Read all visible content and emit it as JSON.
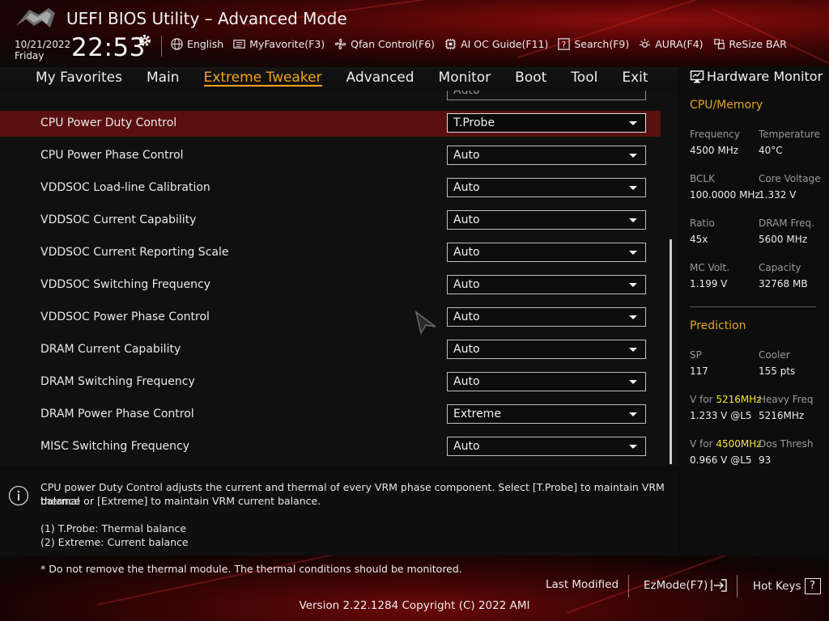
{
  "header": {
    "title": "UEFI BIOS Utility – Advanced Mode",
    "date": "10/21/2022",
    "day": "Friday",
    "time": "22:53",
    "toolbar": [
      {
        "label": "English",
        "icon": "globe-icon"
      },
      {
        "label": "MyFavorite(F3)",
        "icon": "favorite-list-icon"
      },
      {
        "label": "Qfan Control(F6)",
        "icon": "fan-icon"
      },
      {
        "label": "AI OC Guide(F11)",
        "icon": "chip-icon"
      },
      {
        "label": "Search(F9)",
        "icon": "search-question-icon"
      },
      {
        "label": "AURA(F4)",
        "icon": "aura-light-icon"
      },
      {
        "label": "ReSize BAR",
        "icon": "resize-bar-icon"
      }
    ]
  },
  "menu": {
    "items": [
      "My Favorites",
      "Main",
      "Extreme Tweaker",
      "Advanced",
      "Monitor",
      "Boot",
      "Tool",
      "Exit"
    ],
    "active": "Extreme Tweaker"
  },
  "settings": {
    "partial_value": "Auto",
    "rows": [
      {
        "label": "CPU Power Duty Control",
        "value": "T.Probe"
      },
      {
        "label": "CPU Power Phase Control",
        "value": "Auto"
      },
      {
        "label": "VDDSOC Load-line Calibration",
        "value": "Auto"
      },
      {
        "label": "VDDSOC Current Capability",
        "value": "Auto"
      },
      {
        "label": "VDDSOC Current Reporting Scale",
        "value": "Auto"
      },
      {
        "label": "VDDSOC Switching Frequency",
        "value": "Auto"
      },
      {
        "label": "VDDSOC Power Phase Control",
        "value": "Auto"
      },
      {
        "label": "DRAM Current Capability",
        "value": "Auto"
      },
      {
        "label": "DRAM Switching Frequency",
        "value": "Auto"
      },
      {
        "label": "DRAM Power Phase Control",
        "value": "Extreme"
      },
      {
        "label": "MISC Switching Frequency",
        "value": "Auto"
      }
    ]
  },
  "help": {
    "line1": "CPU power Duty Control adjusts the current and thermal of every VRM phase component. Select [T.Probe] to maintain VRM thermal",
    "line2": "balance or [Extreme] to maintain VRM current balance.",
    "line3": "(1) T.Probe: Thermal balance",
    "line4": "(2) Extreme: Current balance"
  },
  "hardware_monitor": {
    "title": "Hardware Monitor",
    "cpu_memory": {
      "heading": "CPU/Memory",
      "frequency_label": "Frequency",
      "frequency": "4500 MHz",
      "temperature_label": "Temperature",
      "temperature": "40°C",
      "bclk_label": "BCLK",
      "bclk": "100.0000 MHz",
      "core_voltage_label": "Core Voltage",
      "core_voltage": "1.332 V",
      "ratio_label": "Ratio",
      "ratio": "45x",
      "dram_freq_label": "DRAM Freq.",
      "dram_freq": "5600 MHz",
      "mc_volt_label": "MC Volt.",
      "mc_volt": "1.199 V",
      "capacity_label": "Capacity",
      "capacity": "32768 MB"
    },
    "prediction": {
      "heading": "Prediction",
      "sp_label": "SP",
      "sp": "117",
      "cooler_label": "Cooler",
      "cooler": "155 pts",
      "v_for_label": "V for",
      "v_for1_freq": "5216MHz",
      "v_for1": "1.233 V @L5",
      "heavy_freq_label": "Heavy Freq",
      "heavy_freq": "5216MHz",
      "v_for2_freq": "4500MHz",
      "v_for2": "0.966 V @L5",
      "dos_thresh_label": "Dos Thresh",
      "dos_thresh": "93"
    }
  },
  "footer": {
    "warning": "* Do not remove the thermal module. The thermal conditions should be monitored.",
    "last_modified": "Last Modified",
    "ezmode": "EzMode(F7)",
    "hot_keys": "Hot Keys",
    "hot_keys_icon_text": "?",
    "version": "Version 2.22.1284 Copyright (C) 2022 AMI"
  },
  "colors": {
    "accent": "#f4a31d",
    "section_heading": "#e2a421",
    "highlight": "#f5e23a",
    "selected_row": "#5a1010"
  }
}
